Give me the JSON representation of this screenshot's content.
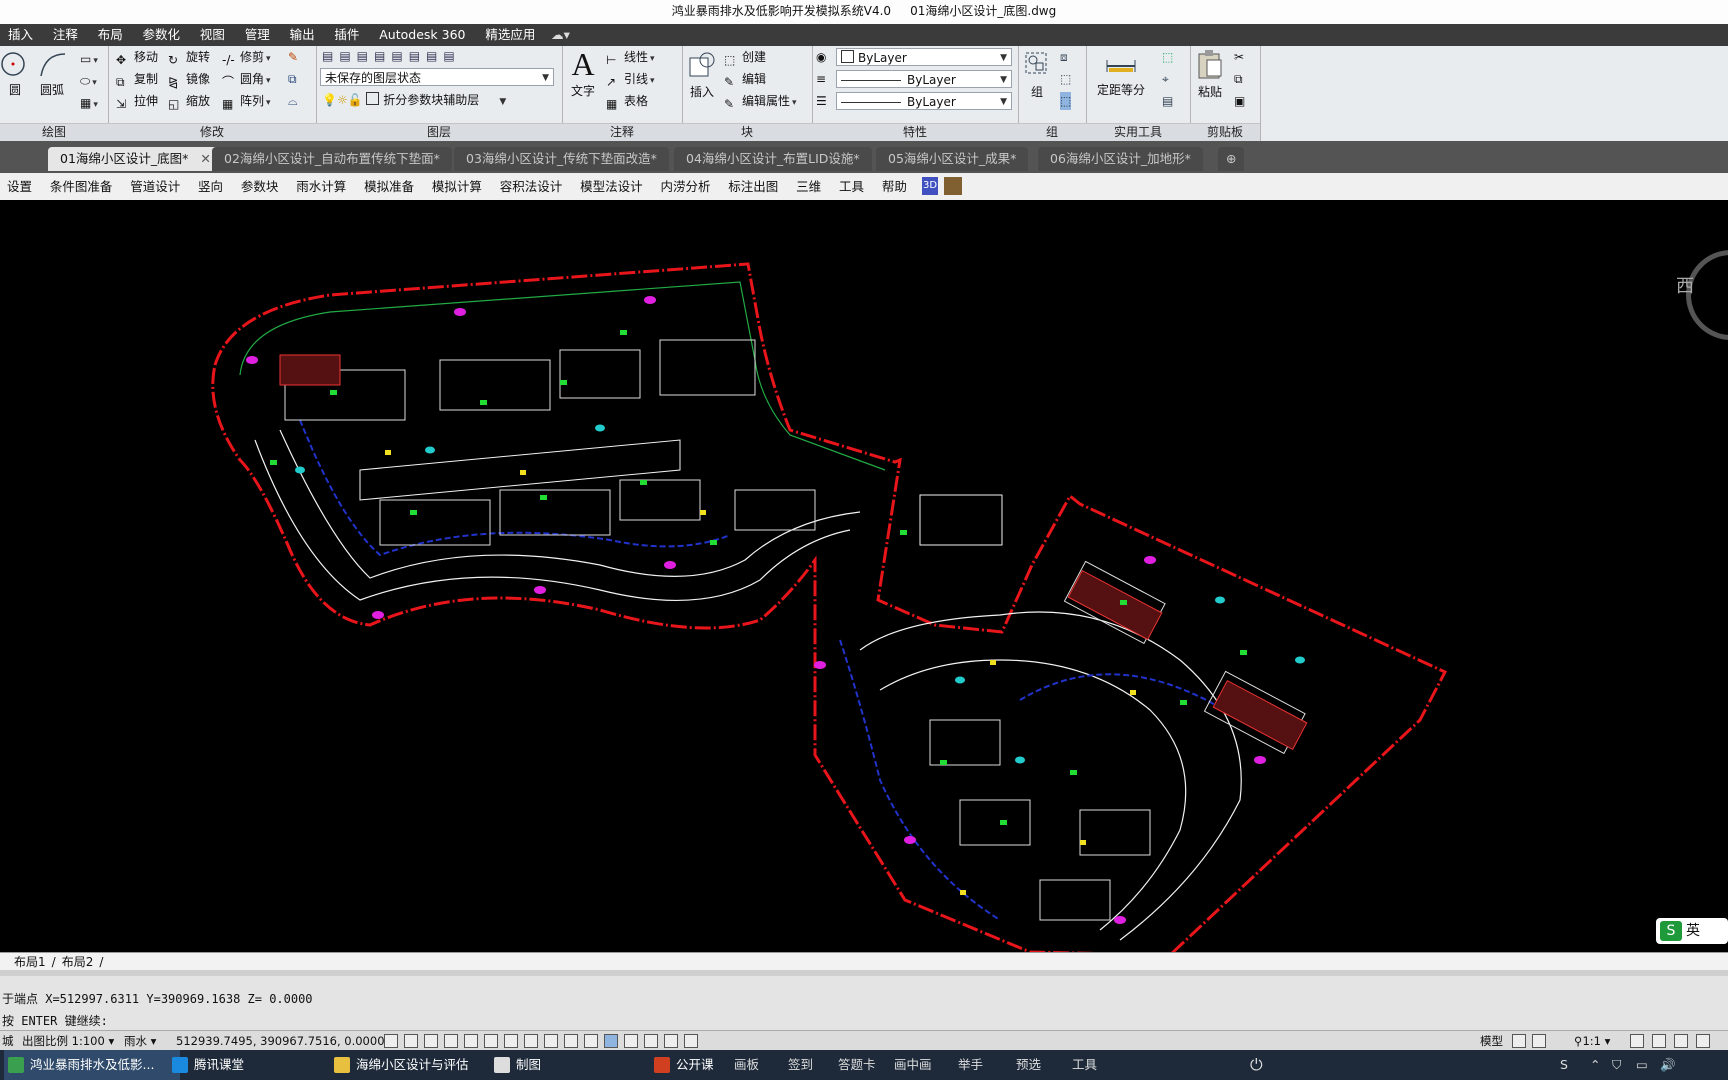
{
  "title": {
    "app": "鸿业暴雨排水及低影响开发模拟系统V4.0",
    "file": "01海绵小区设计_底图.dwg"
  },
  "menu": [
    "插入",
    "注释",
    "布局",
    "参数化",
    "视图",
    "管理",
    "输出",
    "插件",
    "Autodesk 360",
    "精选应用"
  ],
  "ribbon": {
    "draw": {
      "circle": "圆",
      "arc": "圆弧",
      "label": "绘图"
    },
    "modify": {
      "move": "移动",
      "rotate": "旋转",
      "trim": "修剪",
      "copy": "复制",
      "mirror": "镜像",
      "fillet": "圆角",
      "stretch": "拉伸",
      "scale": "缩放",
      "array": "阵列",
      "label": "修改"
    },
    "layers": {
      "state": "未保存的图层状态",
      "current": "折分参数块辅助层",
      "label": "图层"
    },
    "annotation": {
      "text": "文字",
      "linear": "线性",
      "leader": "引线",
      "table": "表格",
      "label": "注释"
    },
    "block": {
      "insert": "插入",
      "create": "创建",
      "edit": "编辑",
      "edit_attr": "编辑属性",
      "label": "块"
    },
    "properties": {
      "color": "ByLayer",
      "linetype": "ByLayer",
      "lineweight": "ByLayer",
      "label": "特性"
    },
    "groups": {
      "group": "组",
      "label": "组"
    },
    "utilities": {
      "measure": "定距等分",
      "label": "实用工具"
    },
    "clipboard": {
      "paste": "粘贴",
      "label": "剪贴板"
    }
  },
  "tabs": [
    "01海绵小区设计_底图*",
    "02海绵小区设计_自动布置传统下垫面*",
    "03海绵小区设计_传统下垫面改造*",
    "04海绵小区设计_布置LID设施*",
    "05海绵小区设计_成果*",
    "06海绵小区设计_加地形*"
  ],
  "app_menu": [
    "设置",
    "条件图准备",
    "管道设计",
    "竖向",
    "参数块",
    "雨水计算",
    "模拟准备",
    "模拟计算",
    "容积法设计",
    "模型法设计",
    "内涝分析",
    "标注出图",
    "三维",
    "工具",
    "帮助"
  ],
  "viewcube": {
    "west": "西"
  },
  "layout_tabs": [
    "布局1",
    "布局2"
  ],
  "command": {
    "line1": "于端点  X=512997.6311  Y=390969.1638  Z=   0.0000",
    "line2": "按 ENTER 键继续:"
  },
  "status": {
    "left": "城",
    "scale": "出图比例 1:100",
    "mode": "雨水",
    "coords": "512939.7495, 390967.7516, 0.0000",
    "model": "模型",
    "anno_scale": "1:1"
  },
  "ime": "英",
  "taskbar": {
    "tasks": [
      "鸿业暴雨排水及低影...",
      "腾讯课堂",
      "海绵小区设计与评估",
      "制图",
      "公开课"
    ],
    "tray": [
      "画板",
      "签到",
      "答题卡",
      "画中画",
      "举手",
      "预选",
      "工具"
    ]
  },
  "colors": {
    "boundary": "#e8151b",
    "road": "#f2f2f2",
    "green": "#22dd33",
    "blue_pipe": "#2233cc",
    "magenta": "#e020e0",
    "cyan": "#22cccc",
    "yellow": "#f0e020",
    "background": "#000000"
  }
}
